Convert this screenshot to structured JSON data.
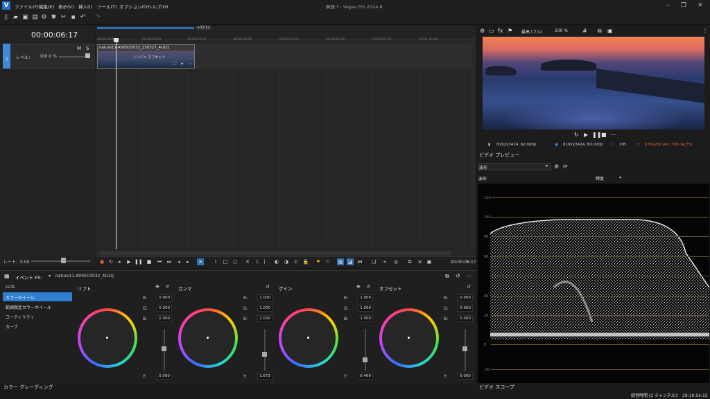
{
  "window": {
    "title": "無題 * - Vegas Pro 2024-8",
    "app_icon": "V",
    "menus": [
      "ファイル(F)",
      "編集(E)",
      "表示(V)",
      "挿入(I)",
      "ツール(T)",
      "オプション(O)",
      "ヘルプ(H)"
    ]
  },
  "timeline": {
    "timecode": "00:00:06:17",
    "loop_marker": "+32:12",
    "ruler_ticks": [
      "00:00:00;00",
      "00:00:10;00",
      "00:00:20;00",
      "00:00:30;00",
      "00:00:40;00",
      "00:00:50;00",
      "00:01:00;00",
      "00:01:10;00",
      "00:01:20;00",
      "00:01:30;00",
      "00:01:40;00",
      "00:01:50;00"
    ],
    "track": {
      "number": "1",
      "mute": "M",
      "solo": "S",
      "level_label": "レベル：",
      "level_value": "100.0 %"
    },
    "clip": {
      "name": "nature11-A005C0032_230327_4U1Q",
      "text": "レンジャ オフセット"
    },
    "rate_label": "レート：0.00",
    "end_time": "00:00:06:17"
  },
  "preview": {
    "quality": "最高 (フル)",
    "zoom": "100 %",
    "info_project": "8192x3424, 60.000p",
    "info_preview": "8192x3424, 60.000p",
    "info_frame": "395",
    "info_display": "676x282 Rec.709 (ACES)",
    "label": "ビデオ プレビュー"
  },
  "scope": {
    "type_select": "波形",
    "mode_label": "波形",
    "channel_select": "輝度",
    "y_ticks": [
      "120",
      "100",
      "80",
      "60",
      "40",
      "20",
      "0",
      "-20"
    ],
    "label": "ビデオ スコープ"
  },
  "grading": {
    "fx_label": "イベント FX:",
    "fx_clip": "nature11-A005C0032_4U1Q",
    "list": [
      "LUTs",
      "カラーホイール",
      "範囲限定カラーホイール",
      "ユーティリティ",
      "カーブ"
    ],
    "wheels": [
      {
        "title": "リフト",
        "R": "0.000",
        "G": "0.000",
        "B": "0.000",
        "Y": "0.000"
      },
      {
        "title": "ガンマ",
        "R": "1.000",
        "G": "1.000",
        "B": "1.000",
        "Y": "1.673"
      },
      {
        "title": "ゲイン",
        "R": "1.000",
        "G": "1.000",
        "B": "1.000",
        "Y": "0.469"
      },
      {
        "title": "オフセット",
        "R": "0.000",
        "G": "0.000",
        "B": "0.000",
        "Y": "0.000"
      }
    ],
    "channel_labels": {
      "R": "R:",
      "G": "G:",
      "B": "B:",
      "Y": "Y:"
    },
    "footer": "カラー グレーディング"
  },
  "status": {
    "text": "録音時間 (2 チャンネル)： 29:10:54:15"
  }
}
